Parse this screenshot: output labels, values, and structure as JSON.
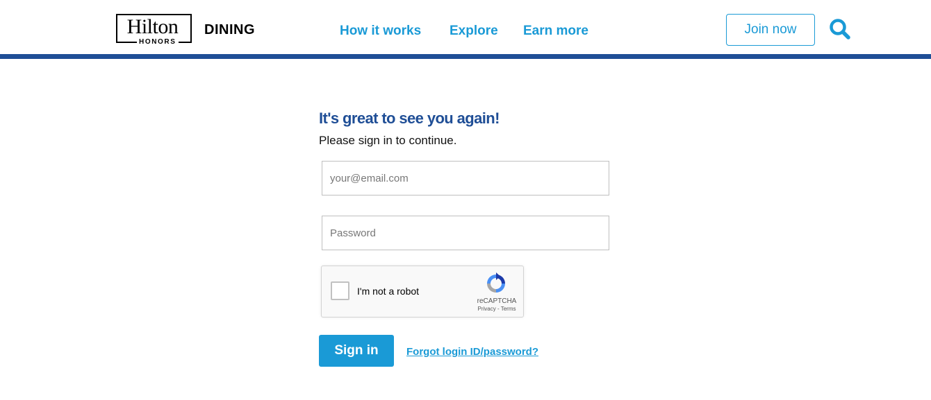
{
  "header": {
    "logo": {
      "wordmark": "Hilton",
      "submark": "HONORS"
    },
    "brand_suffix": "DINING",
    "nav": [
      {
        "label": "How it works"
      },
      {
        "label": "Explore"
      },
      {
        "label": "Earn more"
      }
    ],
    "join_label": "Join now",
    "search_icon": "search-icon",
    "accent_color": "#1a9ad6",
    "bar_color": "#1f4e96"
  },
  "signin": {
    "title": "It's great to see you again!",
    "subtitle": "Please sign in to continue.",
    "email": {
      "value": "",
      "placeholder": "your@email.com"
    },
    "password": {
      "value": "",
      "placeholder": "Password"
    },
    "recaptcha": {
      "label": "I'm not a robot",
      "brand": "reCAPTCHA",
      "links": "Privacy - Terms",
      "checked": false
    },
    "submit_label": "Sign in",
    "forgot_label": "Forgot login ID/password?"
  }
}
